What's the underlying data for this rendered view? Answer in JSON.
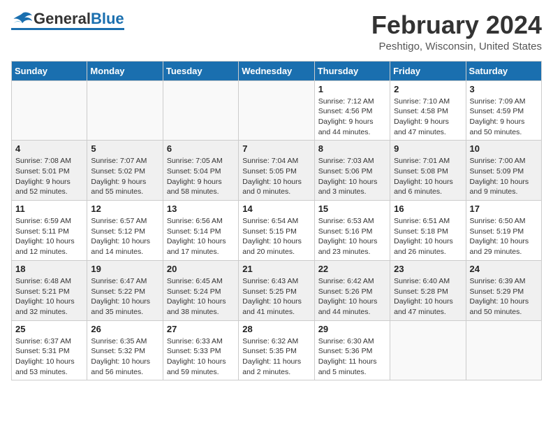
{
  "header": {
    "logo_general": "General",
    "logo_blue": "Blue",
    "month_title": "February 2024",
    "location": "Peshtigo, Wisconsin, United States"
  },
  "weekdays": [
    "Sunday",
    "Monday",
    "Tuesday",
    "Wednesday",
    "Thursday",
    "Friday",
    "Saturday"
  ],
  "weeks": [
    [
      {
        "day": "",
        "info": ""
      },
      {
        "day": "",
        "info": ""
      },
      {
        "day": "",
        "info": ""
      },
      {
        "day": "",
        "info": ""
      },
      {
        "day": "1",
        "info": "Sunrise: 7:12 AM\nSunset: 4:56 PM\nDaylight: 9 hours\nand 44 minutes."
      },
      {
        "day": "2",
        "info": "Sunrise: 7:10 AM\nSunset: 4:58 PM\nDaylight: 9 hours\nand 47 minutes."
      },
      {
        "day": "3",
        "info": "Sunrise: 7:09 AM\nSunset: 4:59 PM\nDaylight: 9 hours\nand 50 minutes."
      }
    ],
    [
      {
        "day": "4",
        "info": "Sunrise: 7:08 AM\nSunset: 5:01 PM\nDaylight: 9 hours\nand 52 minutes."
      },
      {
        "day": "5",
        "info": "Sunrise: 7:07 AM\nSunset: 5:02 PM\nDaylight: 9 hours\nand 55 minutes."
      },
      {
        "day": "6",
        "info": "Sunrise: 7:05 AM\nSunset: 5:04 PM\nDaylight: 9 hours\nand 58 minutes."
      },
      {
        "day": "7",
        "info": "Sunrise: 7:04 AM\nSunset: 5:05 PM\nDaylight: 10 hours\nand 0 minutes."
      },
      {
        "day": "8",
        "info": "Sunrise: 7:03 AM\nSunset: 5:06 PM\nDaylight: 10 hours\nand 3 minutes."
      },
      {
        "day": "9",
        "info": "Sunrise: 7:01 AM\nSunset: 5:08 PM\nDaylight: 10 hours\nand 6 minutes."
      },
      {
        "day": "10",
        "info": "Sunrise: 7:00 AM\nSunset: 5:09 PM\nDaylight: 10 hours\nand 9 minutes."
      }
    ],
    [
      {
        "day": "11",
        "info": "Sunrise: 6:59 AM\nSunset: 5:11 PM\nDaylight: 10 hours\nand 12 minutes."
      },
      {
        "day": "12",
        "info": "Sunrise: 6:57 AM\nSunset: 5:12 PM\nDaylight: 10 hours\nand 14 minutes."
      },
      {
        "day": "13",
        "info": "Sunrise: 6:56 AM\nSunset: 5:14 PM\nDaylight: 10 hours\nand 17 minutes."
      },
      {
        "day": "14",
        "info": "Sunrise: 6:54 AM\nSunset: 5:15 PM\nDaylight: 10 hours\nand 20 minutes."
      },
      {
        "day": "15",
        "info": "Sunrise: 6:53 AM\nSunset: 5:16 PM\nDaylight: 10 hours\nand 23 minutes."
      },
      {
        "day": "16",
        "info": "Sunrise: 6:51 AM\nSunset: 5:18 PM\nDaylight: 10 hours\nand 26 minutes."
      },
      {
        "day": "17",
        "info": "Sunrise: 6:50 AM\nSunset: 5:19 PM\nDaylight: 10 hours\nand 29 minutes."
      }
    ],
    [
      {
        "day": "18",
        "info": "Sunrise: 6:48 AM\nSunset: 5:21 PM\nDaylight: 10 hours\nand 32 minutes."
      },
      {
        "day": "19",
        "info": "Sunrise: 6:47 AM\nSunset: 5:22 PM\nDaylight: 10 hours\nand 35 minutes."
      },
      {
        "day": "20",
        "info": "Sunrise: 6:45 AM\nSunset: 5:24 PM\nDaylight: 10 hours\nand 38 minutes."
      },
      {
        "day": "21",
        "info": "Sunrise: 6:43 AM\nSunset: 5:25 PM\nDaylight: 10 hours\nand 41 minutes."
      },
      {
        "day": "22",
        "info": "Sunrise: 6:42 AM\nSunset: 5:26 PM\nDaylight: 10 hours\nand 44 minutes."
      },
      {
        "day": "23",
        "info": "Sunrise: 6:40 AM\nSunset: 5:28 PM\nDaylight: 10 hours\nand 47 minutes."
      },
      {
        "day": "24",
        "info": "Sunrise: 6:39 AM\nSunset: 5:29 PM\nDaylight: 10 hours\nand 50 minutes."
      }
    ],
    [
      {
        "day": "25",
        "info": "Sunrise: 6:37 AM\nSunset: 5:31 PM\nDaylight: 10 hours\nand 53 minutes."
      },
      {
        "day": "26",
        "info": "Sunrise: 6:35 AM\nSunset: 5:32 PM\nDaylight: 10 hours\nand 56 minutes."
      },
      {
        "day": "27",
        "info": "Sunrise: 6:33 AM\nSunset: 5:33 PM\nDaylight: 10 hours\nand 59 minutes."
      },
      {
        "day": "28",
        "info": "Sunrise: 6:32 AM\nSunset: 5:35 PM\nDaylight: 11 hours\nand 2 minutes."
      },
      {
        "day": "29",
        "info": "Sunrise: 6:30 AM\nSunset: 5:36 PM\nDaylight: 11 hours\nand 5 minutes."
      },
      {
        "day": "",
        "info": ""
      },
      {
        "day": "",
        "info": ""
      }
    ]
  ]
}
